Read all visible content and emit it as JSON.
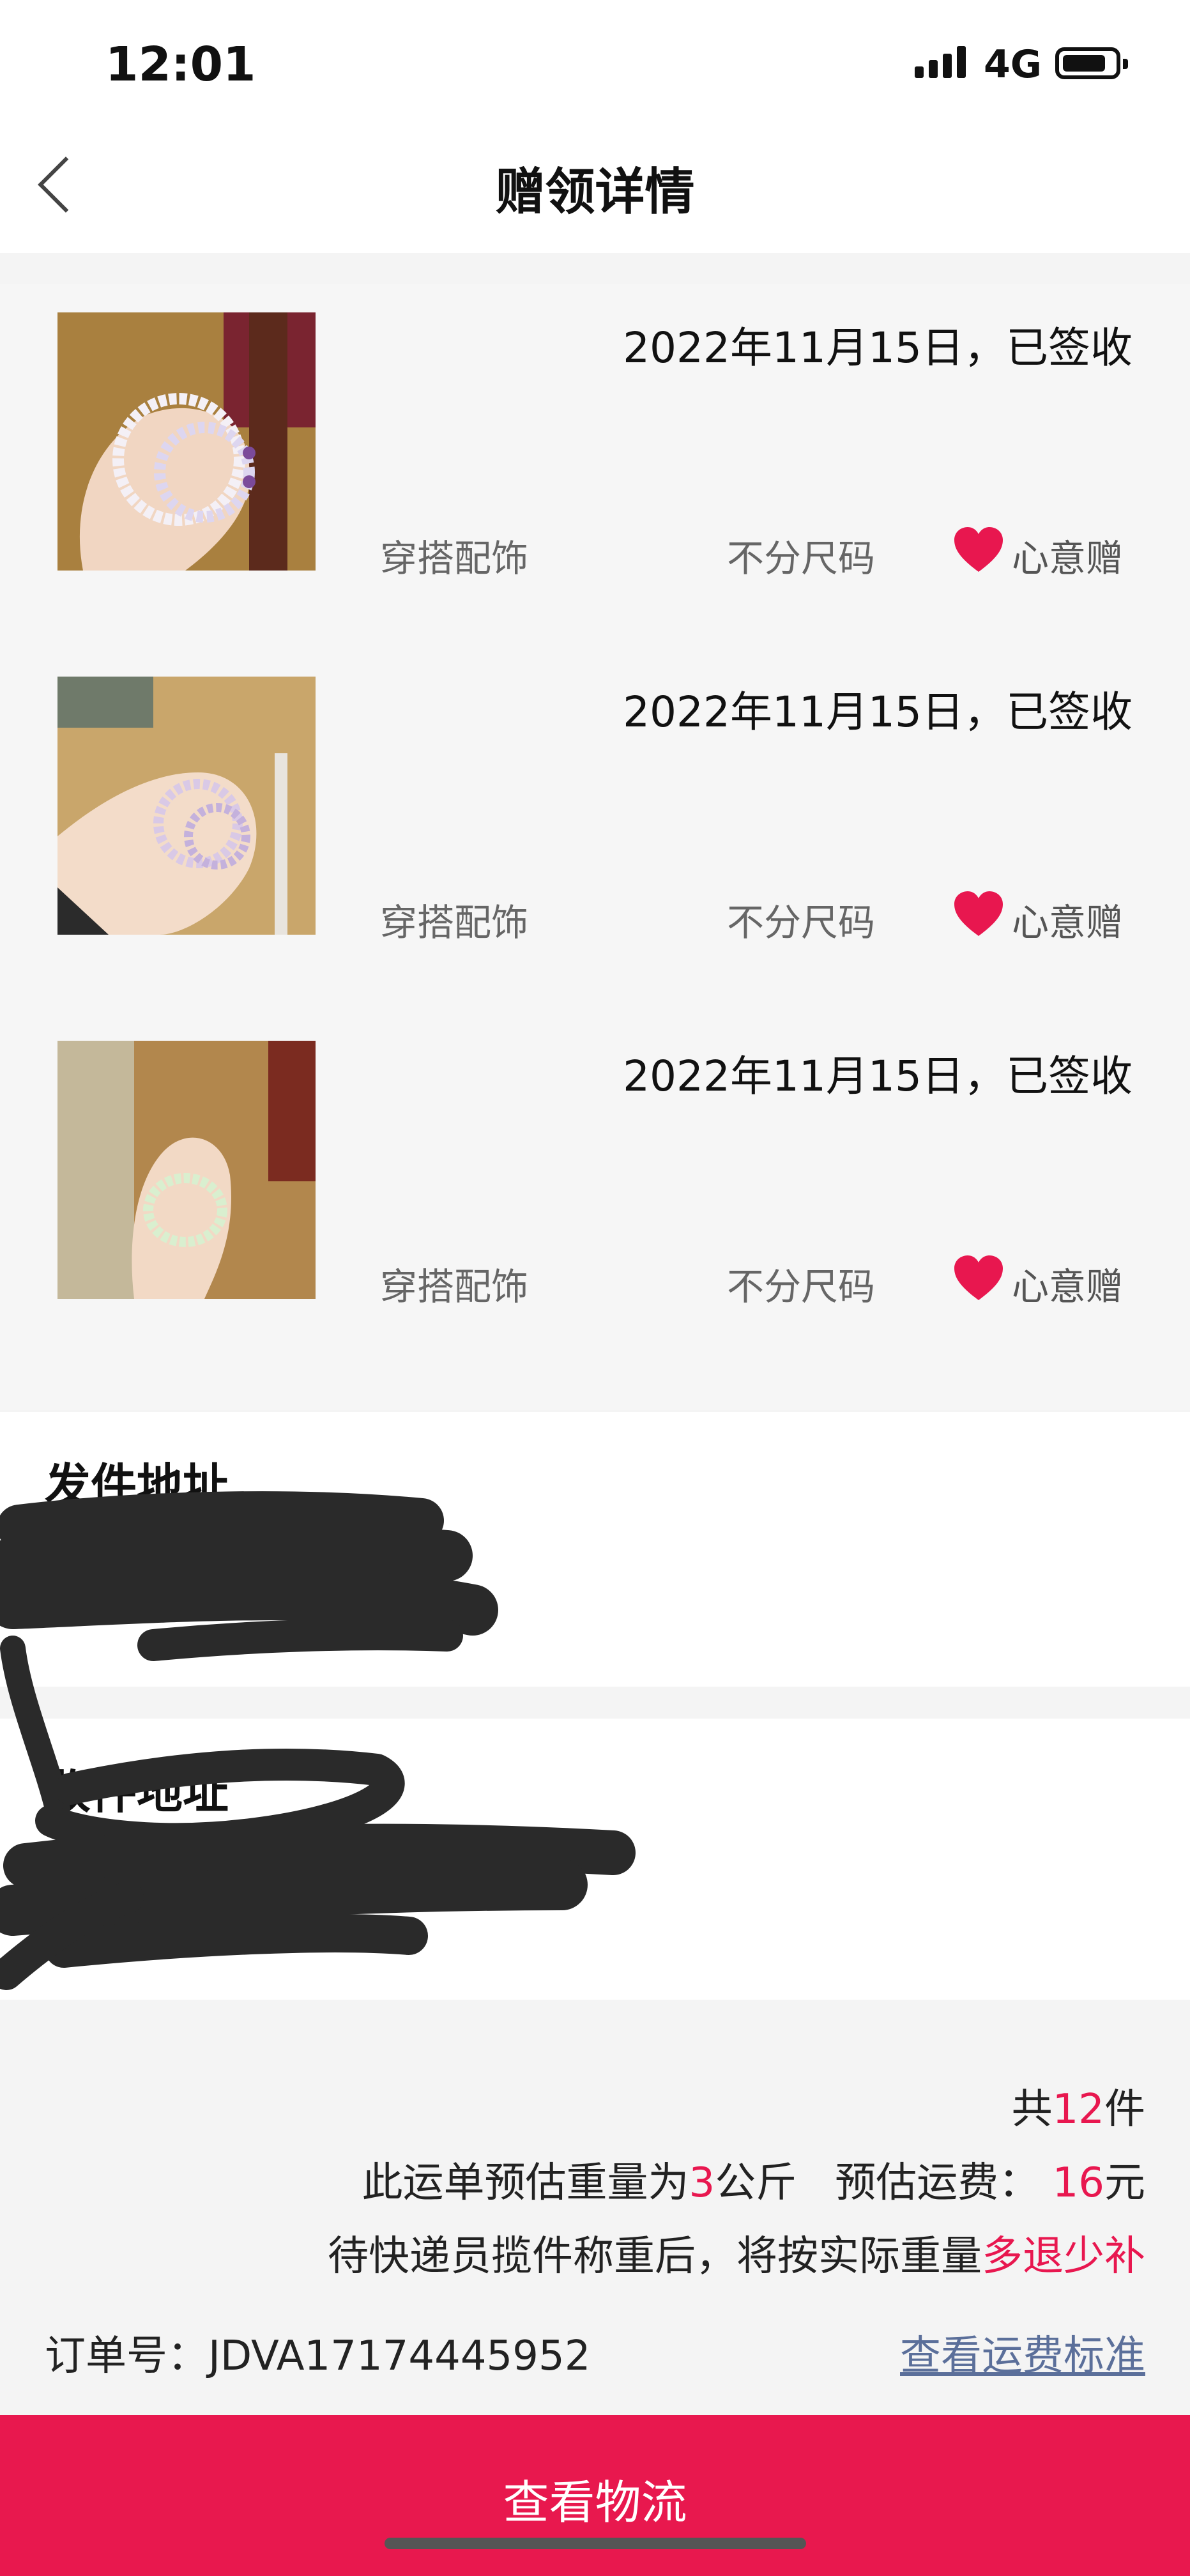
{
  "status_bar": {
    "time": "12:01",
    "network": "4G"
  },
  "nav": {
    "title": "赠领详情"
  },
  "items": [
    {
      "status": "2022年11月15日，已签收",
      "category": "穿搭配饰",
      "size": "不分尺码",
      "tag": "心意赠"
    },
    {
      "status": "2022年11月15日，已签收",
      "category": "穿搭配饰",
      "size": "不分尺码",
      "tag": "心意赠"
    },
    {
      "status": "2022年11月15日，已签收",
      "category": "穿搭配饰",
      "size": "不分尺码",
      "tag": "心意赠"
    }
  ],
  "sender": {
    "label": "发件地址"
  },
  "receiver": {
    "label": "收件地址"
  },
  "summary": {
    "count_prefix": "共",
    "count": "12",
    "count_suffix": "件",
    "weight_prefix": "此运单预估重量为",
    "weight": "3",
    "weight_unit": "公斤",
    "fee_label": "预估运费：",
    "fee": "16",
    "fee_unit": "元",
    "note_prefix": "待快递员揽件称重后，将按实际重量",
    "note_highlight": "多退少补"
  },
  "order": {
    "label": "订单号：",
    "number": "JDVA17174445952",
    "fee_link": "查看运费标准"
  },
  "cta": {
    "label": "查看物流"
  },
  "colors": {
    "accent": "#e8184e",
    "link": "#5b6f9a"
  }
}
